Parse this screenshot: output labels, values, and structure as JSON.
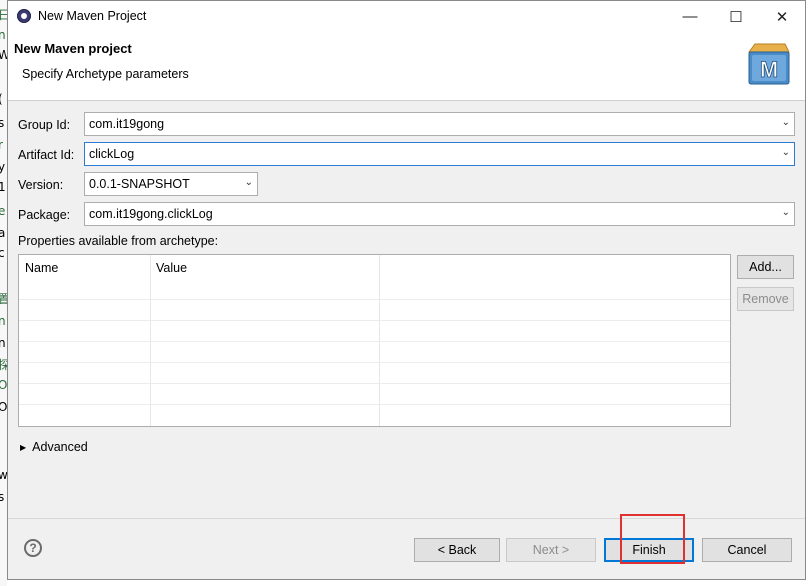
{
  "window": {
    "title": "New Maven Project"
  },
  "header": {
    "title": "New Maven project",
    "subtitle": "Specify Archetype parameters"
  },
  "form": {
    "group_id": {
      "label": "Group Id:",
      "value": "com.it19gong"
    },
    "artifact_id": {
      "label": "Artifact Id:",
      "value": "clickLog"
    },
    "version": {
      "label": "Version:",
      "value": "0.0.1-SNAPSHOT"
    },
    "package": {
      "label": "Package:",
      "value": "com.it19gong.clickLog"
    }
  },
  "properties": {
    "label": "Properties available from archetype:",
    "columns": [
      "Name",
      "Value"
    ],
    "rows": [],
    "add_label": "Add...",
    "remove_label": "Remove"
  },
  "advanced_label": "Advanced",
  "buttons": {
    "back": "< Back",
    "next": "Next >",
    "finish": "Finish",
    "cancel": "Cancel"
  },
  "colors": {
    "highlight": "#e03030",
    "focus_border": "#2b7bd3"
  }
}
